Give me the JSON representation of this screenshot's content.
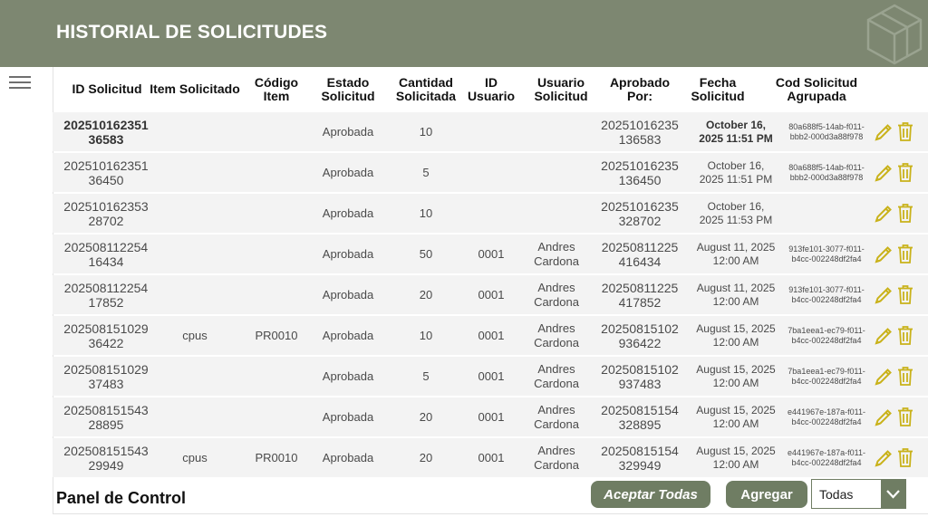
{
  "header": {
    "title": "HISTORIAL DE SOLICITUDES"
  },
  "colors": {
    "header_bg": "#7d8771",
    "accent": "#6f7d63",
    "edit_icon": "#c9b21a",
    "delete_icon": "#c9b21a"
  },
  "table": {
    "columns": [
      {
        "l1": "ID Solicitud",
        "l2": ""
      },
      {
        "l1": "Item Solicitado",
        "l2": ""
      },
      {
        "l1": "Código",
        "l2": "Item"
      },
      {
        "l1": "Estado",
        "l2": "Solicitud"
      },
      {
        "l1": "Cantidad",
        "l2": "Solicitada"
      },
      {
        "l1": "ID",
        "l2": "Usuario"
      },
      {
        "l1": "Usuario",
        "l2": "Solicitud"
      },
      {
        "l1": "Aprobado",
        "l2": "Por:"
      },
      {
        "l1": "Fecha",
        "l2": "Solicitud"
      },
      {
        "l1": "Cod Solicitud",
        "l2": "Agrupada"
      }
    ],
    "rows": [
      {
        "id1": "202510162351",
        "id2": "36583",
        "item": "",
        "code": "",
        "estado": "Aprobada",
        "cantidad": "10",
        "uid": "",
        "user1": "",
        "user2": "",
        "aprob1": "20251016235",
        "aprob2": "136583",
        "fecha1": "October 16,",
        "fecha2": "2025 11:51 PM",
        "grupo1": "80a688f5-14ab-f011-",
        "grupo2": "bbb2-000d3a88f978",
        "selected": true
      },
      {
        "id1": "202510162351",
        "id2": "36450",
        "item": "",
        "code": "",
        "estado": "Aprobada",
        "cantidad": "5",
        "uid": "",
        "user1": "",
        "user2": "",
        "aprob1": "20251016235",
        "aprob2": "136450",
        "fecha1": "October 16,",
        "fecha2": "2025 11:51 PM",
        "grupo1": "80a688f5-14ab-f011-",
        "grupo2": "bbb2-000d3a88f978",
        "selected": false
      },
      {
        "id1": "202510162353",
        "id2": "28702",
        "item": "",
        "code": "",
        "estado": "Aprobada",
        "cantidad": "10",
        "uid": "",
        "user1": "",
        "user2": "",
        "aprob1": "20251016235",
        "aprob2": "328702",
        "fecha1": "October 16,",
        "fecha2": "2025 11:53 PM",
        "grupo1": "",
        "grupo2": "",
        "selected": false
      },
      {
        "id1": "202508112254",
        "id2": "16434",
        "item": "",
        "code": "",
        "estado": "Aprobada",
        "cantidad": "50",
        "uid": "0001",
        "user1": "Andres",
        "user2": "Cardona",
        "aprob1": "20250811225",
        "aprob2": "416434",
        "fecha1": "August 11, 2025",
        "fecha2": "12:00 AM",
        "grupo1": "913fe101-3077-f011-",
        "grupo2": "b4cc-002248df2fa4",
        "selected": false
      },
      {
        "id1": "202508112254",
        "id2": "17852",
        "item": "",
        "code": "",
        "estado": "Aprobada",
        "cantidad": "20",
        "uid": "0001",
        "user1": "Andres",
        "user2": "Cardona",
        "aprob1": "20250811225",
        "aprob2": "417852",
        "fecha1": "August 11, 2025",
        "fecha2": "12:00 AM",
        "grupo1": "913fe101-3077-f011-",
        "grupo2": "b4cc-002248df2fa4",
        "selected": false
      },
      {
        "id1": "202508151029",
        "id2": "36422",
        "item": "cpus",
        "code": "PR0010",
        "estado": "Aprobada",
        "cantidad": "10",
        "uid": "0001",
        "user1": "Andres",
        "user2": "Cardona",
        "aprob1": "20250815102",
        "aprob2": "936422",
        "fecha1": "August 15, 2025",
        "fecha2": "12:00 AM",
        "grupo1": "7ba1eea1-ec79-f011-",
        "grupo2": "b4cc-002248df2fa4",
        "selected": false
      },
      {
        "id1": "202508151029",
        "id2": "37483",
        "item": "",
        "code": "",
        "estado": "Aprobada",
        "cantidad": "5",
        "uid": "0001",
        "user1": "Andres",
        "user2": "Cardona",
        "aprob1": "20250815102",
        "aprob2": "937483",
        "fecha1": "August 15, 2025",
        "fecha2": "12:00 AM",
        "grupo1": "7ba1eea1-ec79-f011-",
        "grupo2": "b4cc-002248df2fa4",
        "selected": false
      },
      {
        "id1": "202508151543",
        "id2": "28895",
        "item": "",
        "code": "",
        "estado": "Aprobada",
        "cantidad": "20",
        "uid": "0001",
        "user1": "Andres",
        "user2": "Cardona",
        "aprob1": "20250815154",
        "aprob2": "328895",
        "fecha1": "August 15, 2025",
        "fecha2": "12:00 AM",
        "grupo1": "e441967e-187a-f011-",
        "grupo2": "b4cc-002248df2fa4",
        "selected": false
      },
      {
        "id1": "202508151543",
        "id2": "29949",
        "item": "cpus",
        "code": "PR0010",
        "estado": "Aprobada",
        "cantidad": "20",
        "uid": "0001",
        "user1": "Andres",
        "user2": "Cardona",
        "aprob1": "20250815154",
        "aprob2": "329949",
        "fecha1": "August 15, 2025",
        "fecha2": "12:00 AM",
        "grupo1": "e441967e-187a-f011-",
        "grupo2": "b4cc-002248df2fa4",
        "selected": false
      }
    ]
  },
  "footer": {
    "panel_title": "Panel de Control",
    "accept_all_label": "Aceptar Todas",
    "add_label": "Agregar",
    "filter_value": "Todas"
  }
}
